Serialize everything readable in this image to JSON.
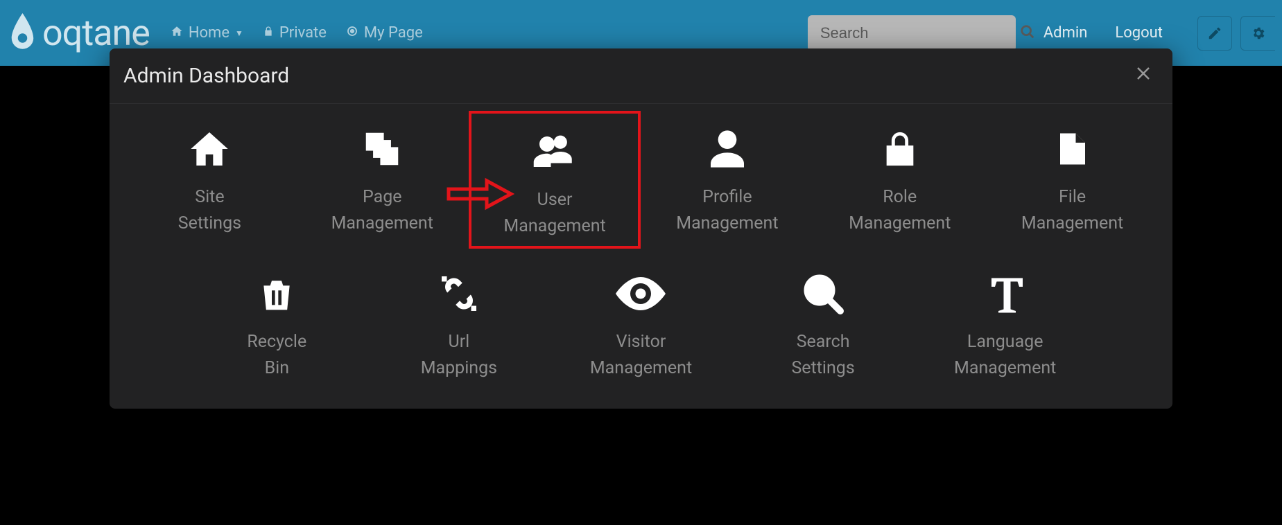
{
  "brand": "oqtane",
  "nav": {
    "home": "Home",
    "private": "Private",
    "mypage": "My Page"
  },
  "search": {
    "placeholder": "Search"
  },
  "right": {
    "admin": "Admin",
    "logout": "Logout"
  },
  "modal": {
    "title": "Admin Dashboard"
  },
  "tiles_row1": [
    {
      "label": "Site\nSettings",
      "icon": "home-icon"
    },
    {
      "label": "Page\nManagement",
      "icon": "pages-icon"
    },
    {
      "label": "User\nManagement",
      "icon": "users-icon",
      "highlight": true
    },
    {
      "label": "Profile\nManagement",
      "icon": "person-icon"
    },
    {
      "label": "Role\nManagement",
      "icon": "lock-icon"
    },
    {
      "label": "File\nManagement",
      "icon": "file-icon"
    }
  ],
  "tiles_row2": [
    {
      "label": "Recycle\nBin",
      "icon": "trash-icon"
    },
    {
      "label": "Url\nMappings",
      "icon": "mapping-icon"
    },
    {
      "label": "Visitor\nManagement",
      "icon": "eye-icon"
    },
    {
      "label": "Search\nSettings",
      "icon": "search-large-icon"
    },
    {
      "label": "Language\nManagement",
      "icon": "text-icon"
    }
  ]
}
